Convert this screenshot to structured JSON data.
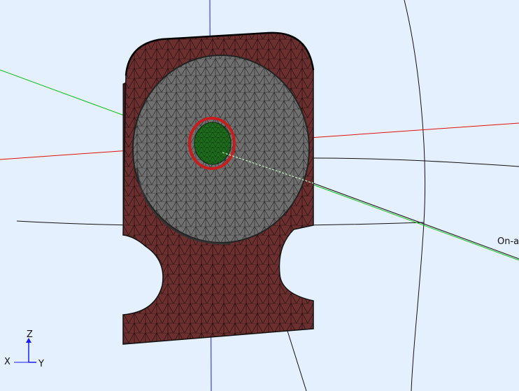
{
  "viewport": {
    "background": "#e4f0fd",
    "annotation_label": "On-a",
    "colors": {
      "mesh_body": "#6b2f2f",
      "mesh_disk": "#6e6e6e",
      "mesh_core": "#1e6b1e",
      "ring": "#c91d1d",
      "axis_red": "#e01010",
      "axis_green": "#10c010",
      "axis_blue": "#1a1aff",
      "wire": "#111111"
    }
  },
  "triad": {
    "z_label": "Z",
    "x_label": "X",
    "y_label": "Y",
    "z_icon": "z-axis-arrow-icon",
    "x_icon": "x-axis-marker-icon",
    "y_icon": "y-axis-arrow-icon"
  }
}
